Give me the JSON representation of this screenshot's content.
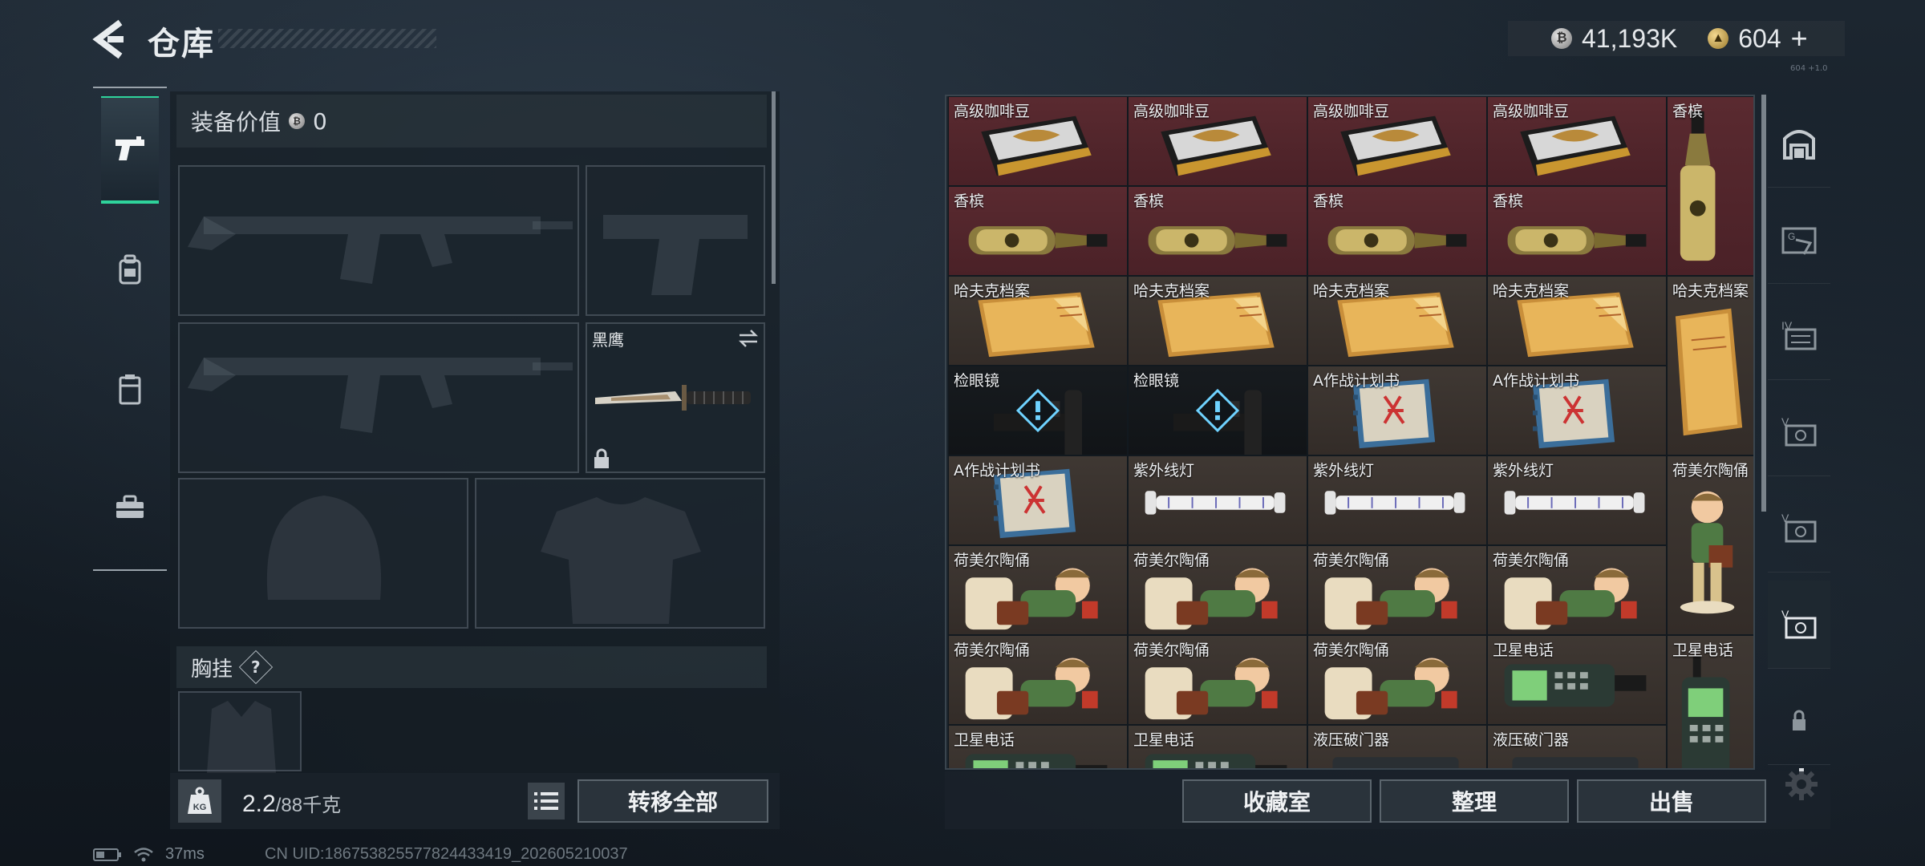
{
  "header": {
    "title": "仓库",
    "silver_amount": "41,193K",
    "gold_amount": "604",
    "gold_add": "+",
    "tiny_note": "604 +1.0"
  },
  "left_tabs": [
    {
      "icon": "pistol-icon",
      "active": true
    },
    {
      "icon": "backpack-icon",
      "active": false
    },
    {
      "icon": "locker-icon",
      "active": false
    },
    {
      "icon": "toolbox-icon",
      "active": false
    }
  ],
  "loadout": {
    "equip_value_label": "装备价值",
    "equip_value": "0",
    "knife_name": "黑鹰",
    "chest_label": "胸挂",
    "chest_help": "?"
  },
  "weight": {
    "icon_label": "KG",
    "current": "2.2",
    "max": "/88千克"
  },
  "transfer_all_label": "转移全部",
  "items": [
    {
      "name": "高级咖啡豆",
      "bg": "red",
      "type": "coffee"
    },
    {
      "name": "高级咖啡豆",
      "bg": "red",
      "type": "coffee"
    },
    {
      "name": "高级咖啡豆",
      "bg": "red",
      "type": "coffee"
    },
    {
      "name": "高级咖啡豆",
      "bg": "red",
      "type": "coffee"
    },
    {
      "name": "香槟",
      "bg": "red",
      "type": "champagne-tall"
    },
    {
      "name": "香槟",
      "bg": "red",
      "type": "champagne"
    },
    {
      "name": "香槟",
      "bg": "red",
      "type": "champagne"
    },
    {
      "name": "香槟",
      "bg": "red",
      "type": "champagne"
    },
    {
      "name": "香槟",
      "bg": "red",
      "type": "champagne"
    },
    {
      "name": "哈夫克档案",
      "bg": "brown",
      "type": "file"
    },
    {
      "name": "哈夫克档案",
      "bg": "brown",
      "type": "file"
    },
    {
      "name": "哈夫克档案",
      "bg": "brown",
      "type": "file"
    },
    {
      "name": "哈夫克档案",
      "bg": "brown",
      "type": "file"
    },
    {
      "name": "哈夫克档案",
      "bg": "brown",
      "type": "file-tall"
    },
    {
      "name": "检眼镜",
      "bg": "dark",
      "type": "scope"
    },
    {
      "name": "检眼镜",
      "bg": "dark",
      "type": "scope"
    },
    {
      "name": "A作战计划书",
      "bg": "brown",
      "type": "plan"
    },
    {
      "name": "A作战计划书",
      "bg": "brown",
      "type": "plan"
    },
    {
      "name": "A作战计划书",
      "bg": "brown",
      "type": "plan"
    },
    {
      "name": "紫外线灯",
      "bg": "brown",
      "type": "uvlamp"
    },
    {
      "name": "紫外线灯",
      "bg": "brown",
      "type": "uvlamp"
    },
    {
      "name": "紫外线灯",
      "bg": "brown",
      "type": "uvlamp"
    },
    {
      "name": "荷美尔陶俑",
      "bg": "brown",
      "type": "figurine-tall"
    },
    {
      "name": "荷美尔陶俑",
      "bg": "brown",
      "type": "figurine"
    },
    {
      "name": "荷美尔陶俑",
      "bg": "brown",
      "type": "figurine"
    },
    {
      "name": "荷美尔陶俑",
      "bg": "brown",
      "type": "figurine"
    },
    {
      "name": "荷美尔陶俑",
      "bg": "brown",
      "type": "figurine"
    },
    {
      "name": "荷美尔陶俑",
      "bg": "brown",
      "type": "figurine"
    },
    {
      "name": "荷美尔陶俑",
      "bg": "brown",
      "type": "figurine"
    },
    {
      "name": "荷美尔陶俑",
      "bg": "brown",
      "type": "figurine"
    },
    {
      "name": "卫星电话",
      "bg": "brown",
      "type": "phone"
    },
    {
      "name": "卫星电话",
      "bg": "brown",
      "type": "phone-tall"
    },
    {
      "name": "卫星电话",
      "bg": "brown",
      "type": "phone"
    },
    {
      "name": "卫星电话",
      "bg": "brown",
      "type": "phone"
    },
    {
      "name": "液压破门器",
      "bg": "brown",
      "type": "breacher"
    },
    {
      "name": "液压破门器",
      "bg": "brown",
      "type": "breacher"
    }
  ],
  "right_tabs": [
    {
      "icon": "vault-icon"
    },
    {
      "icon": "warehouse-g-icon"
    },
    {
      "icon": "warehouse-iv-icon"
    },
    {
      "icon": "warehouse-v-icon"
    },
    {
      "icon": "warehouse-v2-icon"
    },
    {
      "icon": "warehouse-v3-icon",
      "active": true
    },
    {
      "icon": "lock-icon"
    }
  ],
  "bottom_buttons": {
    "collection": "收藏室",
    "organize": "整理",
    "sell": "出售"
  },
  "status": {
    "ping": "37ms",
    "uid": "CN UID:18675382557782443341​9_202605210037"
  },
  "colors": {
    "accent": "#2fd39b",
    "rare_red": "#5a2a30",
    "common_brown": "#3f3833"
  }
}
